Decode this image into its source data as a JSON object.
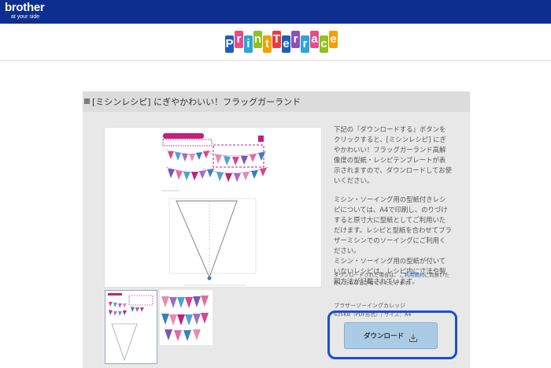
{
  "topbar": {
    "brand": "brother",
    "tagline": "at your side"
  },
  "header": {
    "logo_letters": [
      "P",
      "r",
      "i",
      "n",
      "t",
      "T",
      "e",
      "r",
      "r",
      "a",
      "c",
      "e"
    ],
    "logo_colors": [
      "#1e5fb8",
      "#e94a8a",
      "#2aa6d9",
      "#8dc21f",
      "#f2a100",
      "#e83c3c",
      "#1e5fb8",
      "#8e4fb5",
      "#2aa6d9",
      "#e94a8a",
      "#8dc21f",
      "#f2a100"
    ]
  },
  "article": {
    "title": "[ミシンレシピ] にぎやかわいい！フラッグガーランド",
    "description": [
      "下記の『ダウンロードする』ボタンをクリックすると、[ミシンレシピ] にぎやかわいい！フラッグガーランド高解像度の型紙・レシピテンプレートが表示されますので、ダウンロードしてお使いください。",
      "ミシン・ソーイング用の型紙付きレシピについては、A4で印刷し、のりづけすると原寸大に型紙としてご利用いただけます。レシピと型紙を合わせてブラザーミシンでのソーイングにご利用ください。",
      "ミシン・ソーイング用の型紙が付いていないレシピは、レシピ内に寸法や製図方法が記載されています。"
    ],
    "note_prefix": "ダウンロードされた場合は、",
    "note_link": "ご利用規約",
    "note_suffix": "に同意いただいたものとさせていただきます。",
    "author": "ブラザーソーイングカレッジ",
    "file_info": "635KB（PDF形式）/ サイズ：A4",
    "download_label": "ダウンロード",
    "highlight_color": "#1a4fd6"
  }
}
